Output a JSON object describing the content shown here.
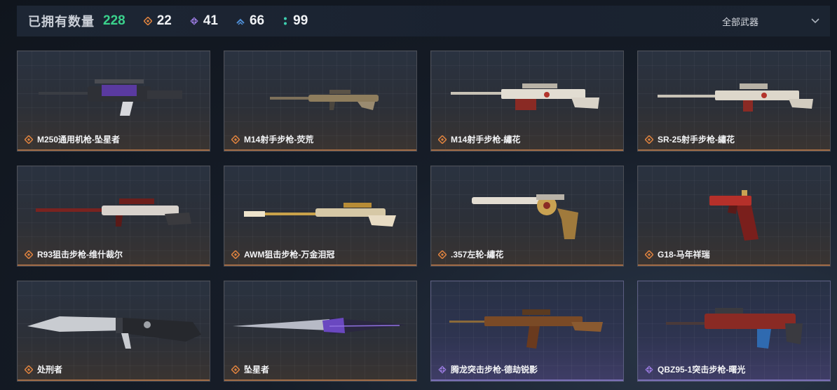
{
  "header": {
    "owned_label": "已拥有数量",
    "owned_total": "228",
    "stats": [
      {
        "icon": "orange-diamond-icon",
        "color": "#d9803f",
        "value": "22"
      },
      {
        "icon": "purple-diamond-icon",
        "color": "#9a7ae0",
        "value": "41"
      },
      {
        "icon": "blue-chevron-icon",
        "color": "#4f8ed6",
        "value": "66"
      },
      {
        "icon": "teal-dots-icon",
        "color": "#3ecfb0",
        "value": "99"
      }
    ],
    "filter_label": "全部武器"
  },
  "rarity_colors": {
    "orange": "#d9803f",
    "purple": "#9a7ae0"
  },
  "items": [
    {
      "name": "M250通用机枪-坠星者",
      "rarity": "orange",
      "type": "mg"
    },
    {
      "name": "M14射手步枪-荧荒",
      "rarity": "orange",
      "type": "rifle"
    },
    {
      "name": "M14射手步枪-繡花",
      "rarity": "orange",
      "type": "rifle"
    },
    {
      "name": "SR-25射手步枪-繡花",
      "rarity": "orange",
      "type": "rifle"
    },
    {
      "name": "R93狙击步枪-维什裁尔",
      "rarity": "orange",
      "type": "sniper"
    },
    {
      "name": "AWM狙击步枪-万金泪冠",
      "rarity": "orange",
      "type": "sniper"
    },
    {
      "name": ".357左轮-繡花",
      "rarity": "orange",
      "type": "revolver"
    },
    {
      "name": "G18-马年祥瑞",
      "rarity": "orange",
      "type": "pistol"
    },
    {
      "name": "处刑者",
      "rarity": "orange",
      "type": "knife"
    },
    {
      "name": "坠星者",
      "rarity": "orange",
      "type": "blade"
    },
    {
      "name": "腾龙突击步枪-德劫锐影",
      "rarity": "purple",
      "type": "assault"
    },
    {
      "name": "QBZ95-1突击步枪-曙光",
      "rarity": "purple",
      "type": "bullpup"
    }
  ]
}
